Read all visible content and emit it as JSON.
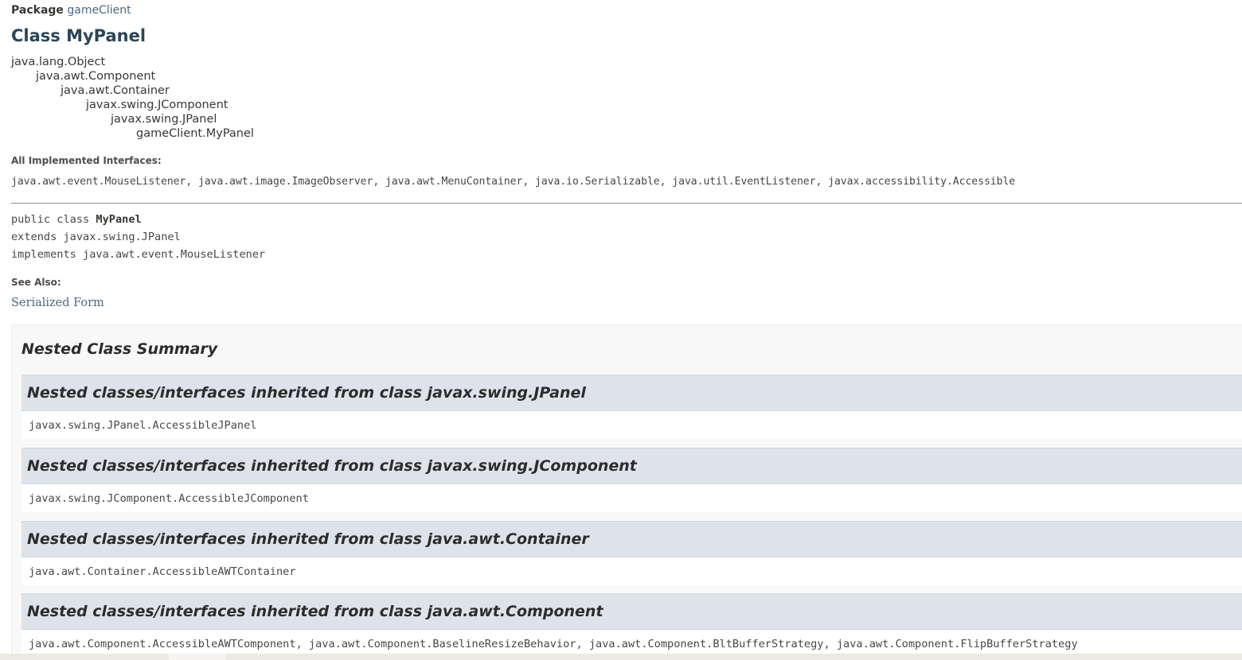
{
  "package": {
    "label": "Package",
    "name": "gameClient"
  },
  "class_title": "Class MyPanel",
  "hierarchy": [
    "java.lang.Object",
    "java.awt.Component",
    "java.awt.Container",
    "javax.swing.JComponent",
    "javax.swing.JPanel",
    "gameClient.MyPanel"
  ],
  "interfaces": {
    "heading": "All Implemented Interfaces:",
    "list": "java.awt.event.MouseListener, java.awt.image.ImageObserver, java.awt.MenuContainer, java.io.Serializable, java.util.EventListener, javax.accessibility.Accessible"
  },
  "signature": {
    "line1_prefix": "public class ",
    "line1_name": "MyPanel",
    "line2": "extends javax.swing.JPanel",
    "line3": "implements java.awt.event.MouseListener"
  },
  "see_also": {
    "heading": "See Also:",
    "link": "Serialized Form"
  },
  "nested_summary": {
    "title": "Nested Class Summary",
    "sections": [
      {
        "header": "Nested classes/interfaces inherited from class javax.swing.JPanel",
        "items": "javax.swing.JPanel.AccessibleJPanel"
      },
      {
        "header": "Nested classes/interfaces inherited from class javax.swing.JComponent",
        "items": "javax.swing.JComponent.AccessibleJComponent"
      },
      {
        "header": "Nested classes/interfaces inherited from class java.awt.Container",
        "items": "java.awt.Container.AccessibleAWTContainer"
      },
      {
        "header": "Nested classes/interfaces inherited from class java.awt.Component",
        "items": "java.awt.Component.AccessibleAWTComponent, java.awt.Component.BaselineResizeBehavior, java.awt.Component.BltBufferStrategy, java.awt.Component.FlipBufferStrategy"
      }
    ]
  }
}
